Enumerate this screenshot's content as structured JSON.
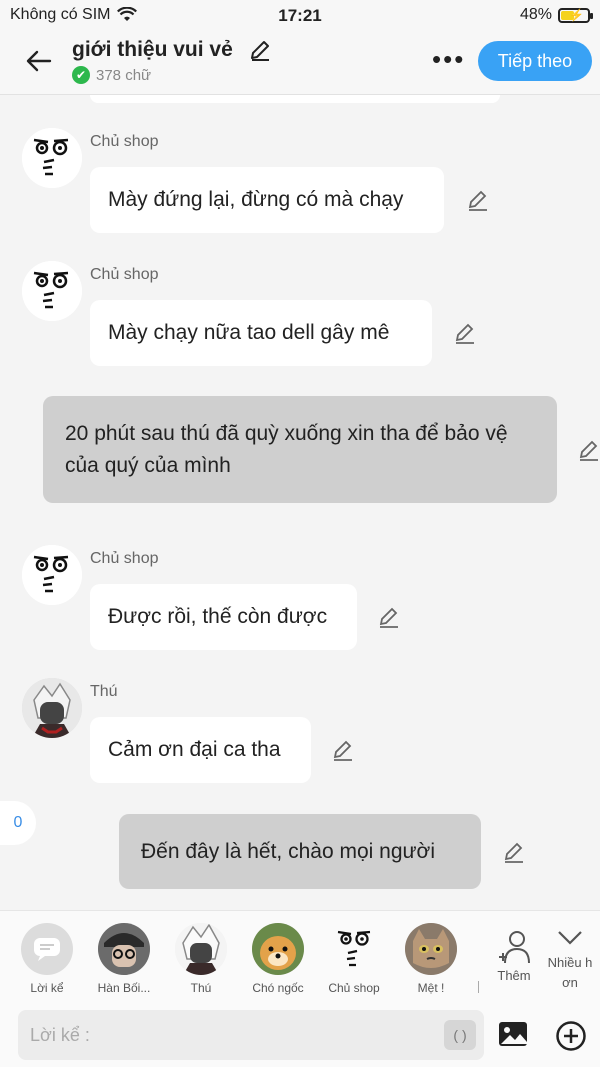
{
  "status": {
    "carrier": "Không có SIM",
    "time": "17:21",
    "battery": "48%"
  },
  "header": {
    "title": "giới thiệu vui vẻ",
    "wordcount": "378 chữ",
    "next_label": "Tiếp theo"
  },
  "messages": [
    {
      "sender": "Chủ shop",
      "text": "Mày đứng lại, đừng có mà chạy"
    },
    {
      "sender": "Chủ shop",
      "text": "Mày chạy nữa tao dell gây mê"
    },
    {
      "sender": "",
      "text": "20 phút sau thú đã quỳ xuống xin tha để bảo vệ của quý của mình"
    },
    {
      "sender": "Chủ shop",
      "text": "Được rồi, thế còn được"
    },
    {
      "sender": "Thú",
      "text": "Cảm ơn đại ca tha"
    },
    {
      "sender": "",
      "text": "Đến đây là hết, chào mọi người"
    }
  ],
  "side_badge": "0",
  "cast": [
    {
      "label": "Lời kể"
    },
    {
      "label": "Hàn Bối..."
    },
    {
      "label": "Thú"
    },
    {
      "label": "Chó ngốc"
    },
    {
      "label": "Chủ shop"
    },
    {
      "label": "Mệt !"
    }
  ],
  "add_label": "Thêm",
  "many_label": "Nhiều h ơn",
  "input": {
    "placeholder": "Lời kể :",
    "paren": "( )"
  },
  "colors": {
    "accent": "#39a2f5",
    "check": "#2db84d",
    "gray_bubble": "#cfcfcf"
  }
}
